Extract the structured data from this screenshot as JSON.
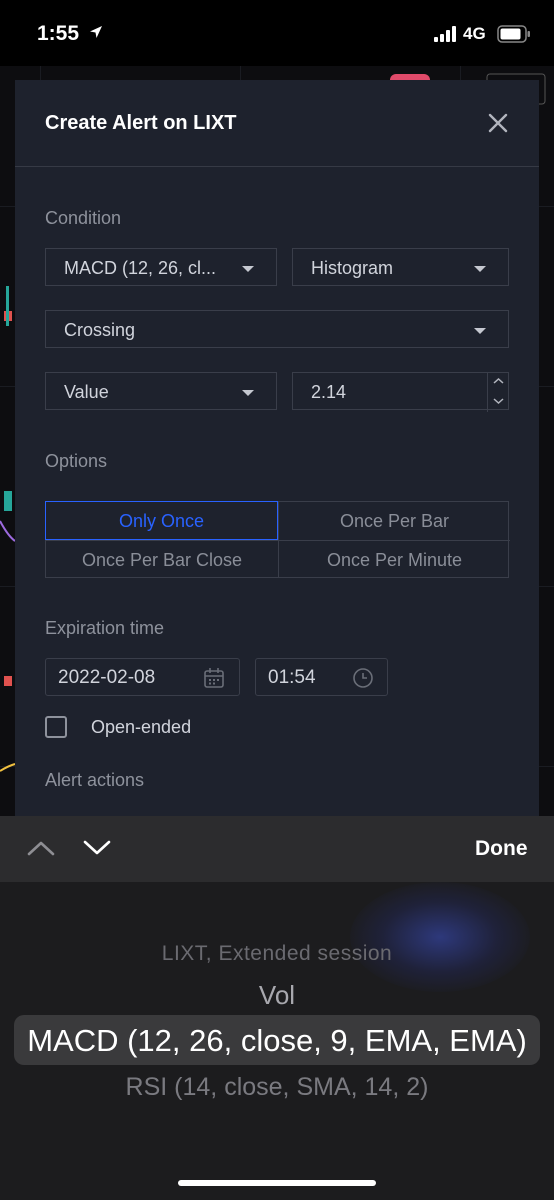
{
  "status_bar": {
    "time": "1:55",
    "network": "4G"
  },
  "modal": {
    "title": "Create Alert on LIXT",
    "condition_label": "Condition",
    "indicator_select": "MACD (12, 26, cl...",
    "line_select": "Histogram",
    "operator_select": "Crossing",
    "value_type_select": "Value",
    "value_input": "2.14",
    "options_label": "Options",
    "options": [
      {
        "label": "Only Once",
        "selected": true
      },
      {
        "label": "Once Per Bar",
        "selected": false
      },
      {
        "label": "Once Per Bar Close",
        "selected": false
      },
      {
        "label": "Once Per Minute",
        "selected": false
      }
    ],
    "expiration_label": "Expiration time",
    "expiration_date": "2022-02-08",
    "expiration_time": "01:54",
    "open_ended_label": "Open-ended",
    "open_ended_checked": false,
    "alert_actions_label": "Alert actions"
  },
  "picker": {
    "done_label": "Done",
    "items": [
      "LIXT, Extended session",
      "Vol",
      "MACD (12, 26, close, 9, EMA, EMA)",
      "RSI (14, close, SMA, 14, 2)"
    ],
    "selected_index": 2
  },
  "colors": {
    "modal_bg": "#1e222d",
    "accent": "#2962ff",
    "muted_text": "#8e929c",
    "border": "#3a3e4a"
  }
}
